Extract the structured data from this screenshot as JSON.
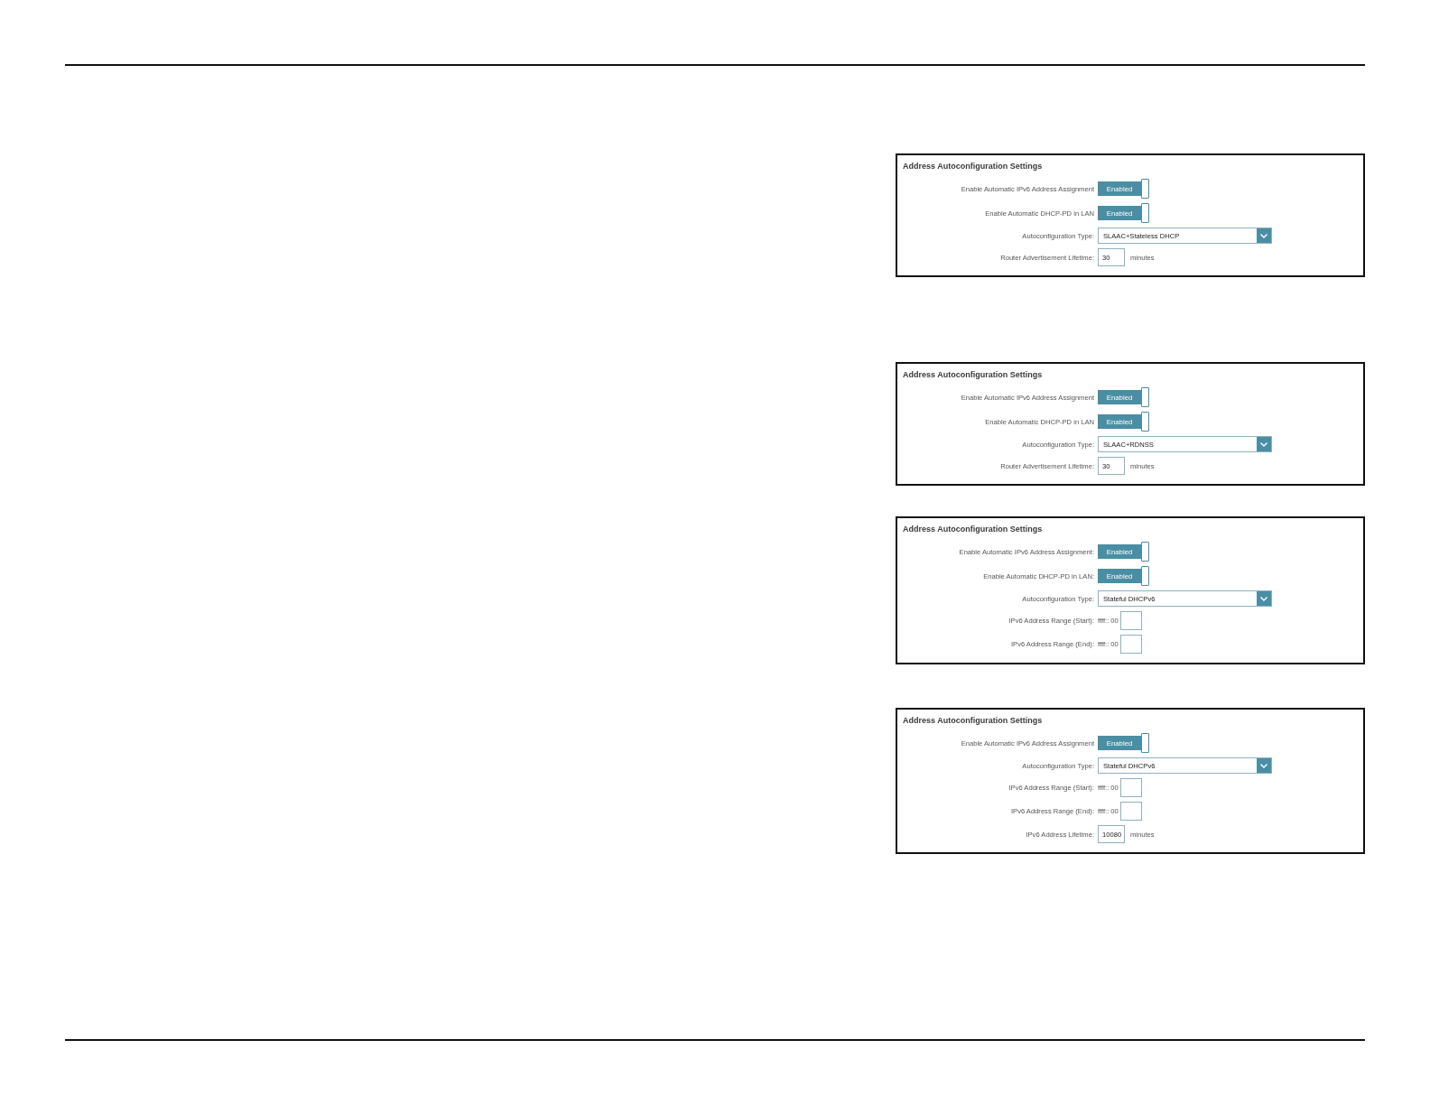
{
  "panels": [
    {
      "title": "Address Autoconfiguration Settings",
      "rows": [
        {
          "kind": "toggle",
          "label": "Enable Automatic IPv6 Address Assignment",
          "on": true,
          "state_label": "Enabled"
        },
        {
          "kind": "toggle",
          "label": "Enable Automatic DHCP-PD in LAN",
          "on": true,
          "state_label": "Enabled"
        },
        {
          "kind": "select",
          "label": "Autoconfiguration Type:",
          "value": "SLAAC+Stateless DHCP"
        },
        {
          "kind": "number",
          "label": "Router Advertisement Lifetime:",
          "value": "30",
          "unit": "minutes"
        }
      ]
    },
    {
      "title": "Address Autoconfiguration Settings",
      "rows": [
        {
          "kind": "toggle",
          "label": "Enable Automatic IPv6 Address Assignment",
          "on": true,
          "state_label": "Enabled"
        },
        {
          "kind": "toggle",
          "label": "Enable Automatic DHCP-PD in LAN",
          "on": true,
          "state_label": "Enabled"
        },
        {
          "kind": "select",
          "label": "Autoconfiguration Type:",
          "value": "SLAAC+RDNSS"
        },
        {
          "kind": "number",
          "label": "Router Advertisement Lifetime:",
          "value": "30",
          "unit": "minutes"
        }
      ]
    },
    {
      "title": "Address Autoconfiguration Settings",
      "rows": [
        {
          "kind": "toggle",
          "label": "Enable Automatic IPv6 Address Assignment:",
          "on": true,
          "state_label": "Enabled"
        },
        {
          "kind": "toggle",
          "label": "Enable Automatic DHCP-PD in LAN:",
          "on": true,
          "state_label": "Enabled"
        },
        {
          "kind": "select",
          "label": "Autoconfiguration Type:",
          "value": "Stateful DHCPv6"
        },
        {
          "kind": "range",
          "label": "IPv6 Address Range (Start):",
          "prefix": "ffff:: 00"
        },
        {
          "kind": "range",
          "label": "IPv6 Address Range (End):",
          "prefix": "ffff:: 00"
        }
      ]
    },
    {
      "title": "Address Autoconfiguration Settings",
      "rows": [
        {
          "kind": "toggle",
          "label": "Enable Automatic IPv6 Address Assignment",
          "on": true,
          "state_label": "Enabled"
        },
        {
          "kind": "select",
          "label": "Autoconfiguration Type:",
          "value": "Stateful DHCPv6"
        },
        {
          "kind": "range",
          "label": "IPv6 Address Range (Start):",
          "prefix": "ffff:: 00"
        },
        {
          "kind": "range",
          "label": "IPv6 Address Range (End):",
          "prefix": "ffff:: 00"
        },
        {
          "kind": "number",
          "label": "IPv6 Address Lifetime:",
          "value": "10080",
          "unit": "minutes"
        }
      ]
    }
  ]
}
